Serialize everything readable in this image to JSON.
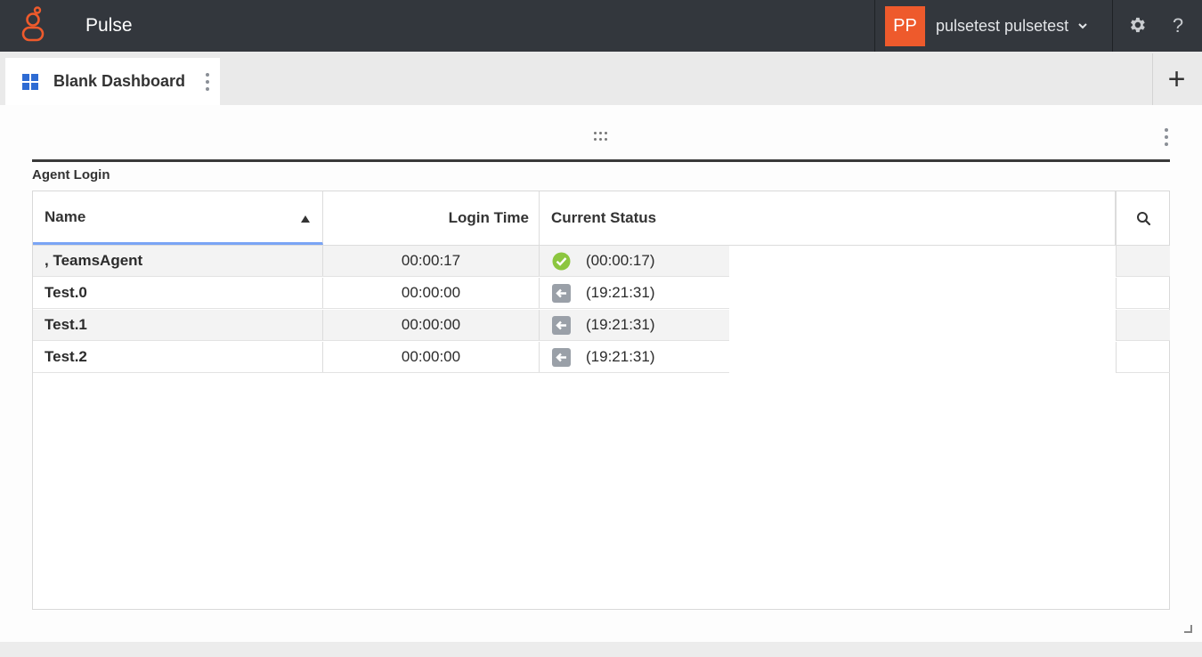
{
  "app": {
    "title": "Pulse"
  },
  "user": {
    "initials": "PP",
    "name": "pulsetest pulsetest"
  },
  "icons": {
    "logo": "genesys-logo-icon",
    "gear": "gear-icon",
    "help": "?",
    "add": "+",
    "search": "search-icon"
  },
  "colors": {
    "topbar": "#33373d",
    "avatar": "#ee5a2c",
    "tab_icon": "#2e6bd3",
    "sort_underline": "#7aa4f5",
    "status_ready": "#8cc63f",
    "status_logged_out": "#9aa0a8"
  },
  "tabs": [
    {
      "label": "Blank Dashboard",
      "active": true
    }
  ],
  "widget": {
    "title": "Agent Login",
    "columns": {
      "name": "Name",
      "login_time": "Login Time",
      "current_status": "Current Status"
    },
    "sort": {
      "column": "Name",
      "direction": "ascending"
    },
    "rows": [
      {
        "name": ", TeamsAgent",
        "login_time": "00:00:17",
        "status_icon": "check-circle-icon",
        "status_time": "(00:00:17)"
      },
      {
        "name": "Test.0",
        "login_time": "00:00:00",
        "status_icon": "logout-arrow-icon",
        "status_time": "(19:21:31)"
      },
      {
        "name": "Test.1",
        "login_time": "00:00:00",
        "status_icon": "logout-arrow-icon",
        "status_time": "(19:21:31)"
      },
      {
        "name": "Test.2",
        "login_time": "00:00:00",
        "status_icon": "logout-arrow-icon",
        "status_time": "(19:21:31)"
      }
    ]
  }
}
